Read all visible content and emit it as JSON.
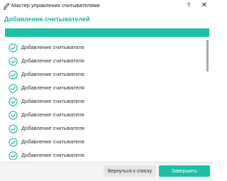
{
  "window": {
    "title": "Мастер управления считывателями",
    "icon": "edit-pencil-icon",
    "help_label": "?",
    "close_label": "✕"
  },
  "heading": "Добавление считывателей",
  "progress": {
    "percent": 100,
    "color": "#1cc1a4"
  },
  "list": {
    "items": [
      {
        "label": "Добавление считывателя",
        "status": "done"
      },
      {
        "label": "Добавление считывателя",
        "status": "done"
      },
      {
        "label": "Добавление считывателя",
        "status": "done"
      },
      {
        "label": "Добавление считывателя",
        "status": "done"
      },
      {
        "label": "Добавление считывателя",
        "status": "done"
      },
      {
        "label": "Добавление считывателя",
        "status": "done"
      },
      {
        "label": "Добавление считывателя",
        "status": "done"
      },
      {
        "label": "Добавление считывателя",
        "status": "done"
      },
      {
        "label": "Добавление считывателя",
        "status": "done"
      }
    ]
  },
  "footer": {
    "back_label": "Вернуться к списку",
    "finish_label": "Завершить"
  },
  "colors": {
    "accent": "#1eb89e",
    "button_primary": "#1cc1a4"
  }
}
